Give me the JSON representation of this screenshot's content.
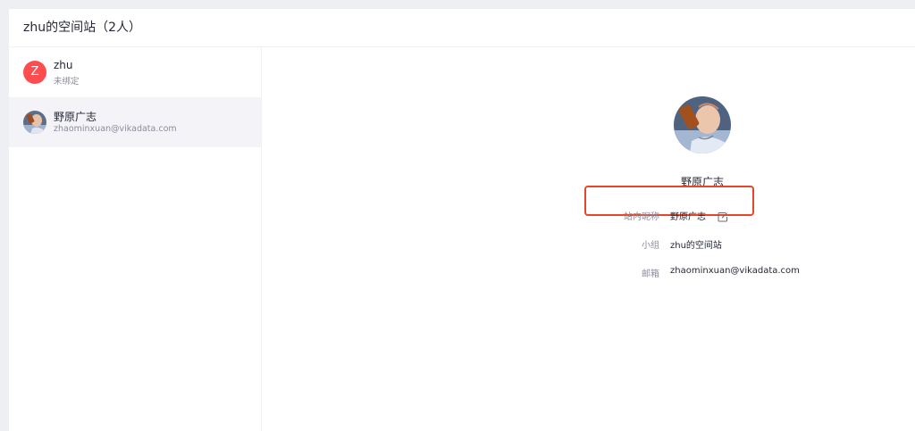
{
  "header": {
    "title": "zhu的空间站（2人）"
  },
  "members": [
    {
      "avatar_letter": "Z",
      "avatar_color": "#ff4d4f",
      "name": "zhu",
      "sub": "未绑定"
    },
    {
      "avatar_icon": "user-photo-icon",
      "name": "野原广志",
      "sub": "zhaominxuan@vikadata.com",
      "selected": true
    }
  ],
  "detail": {
    "avatar_icon": "user-photo-icon",
    "name": "野原广志",
    "nickname": {
      "label": "站内昵称",
      "value": "野原广志",
      "icon": "edit-icon"
    },
    "team": {
      "label": "小组",
      "value": "zhu的空间站"
    },
    "email": {
      "label": "邮箱",
      "value": "zhaominxuan@vikadata.com"
    }
  },
  "colors": {
    "highlight": "#e8462a",
    "selected_row": "#f3f3f8"
  }
}
